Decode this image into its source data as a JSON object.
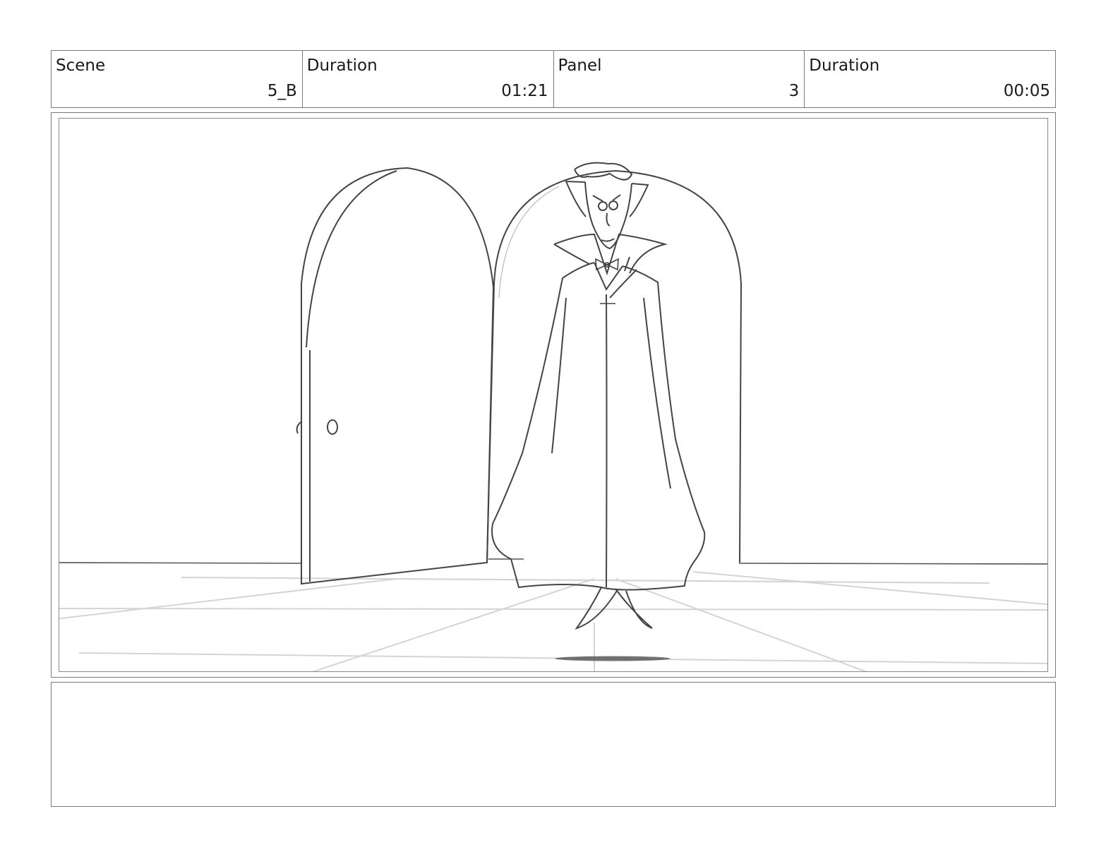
{
  "header": {
    "scene_label": "Scene",
    "scene_value": "5_B",
    "scene_duration_label": "Duration",
    "scene_duration_value": "01:21",
    "panel_label": "Panel",
    "panel_value": "3",
    "panel_duration_label": "Duration",
    "panel_duration_value": "00:05"
  },
  "notes": {
    "text": ""
  }
}
